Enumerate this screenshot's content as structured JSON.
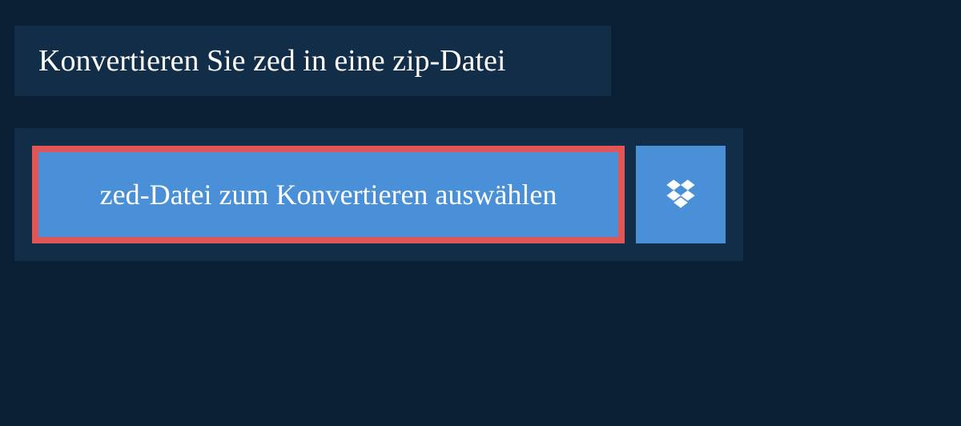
{
  "header": {
    "title": "Konvertieren Sie zed in eine zip-Datei"
  },
  "upload": {
    "select_file_label": "zed-Datei zum Konvertieren auswählen"
  }
}
